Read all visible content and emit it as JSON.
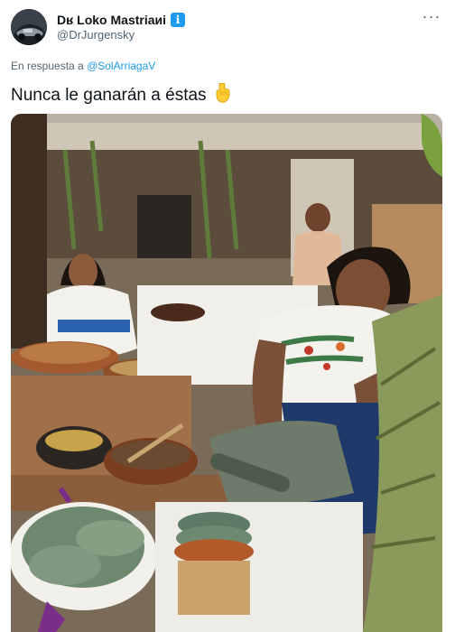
{
  "tweet": {
    "display_name": "Dʁ Loko Mastriaиi",
    "verified_icon": "verified-badge-icon",
    "verified_glyph": "i",
    "handle": "@DrJurgensky",
    "reply_prefix": "En respuesta a",
    "reply_mention": "@SolArriagaV",
    "text": "Nunca le ganarán a éstas",
    "emoji": "pointing-down-hand-icon",
    "more_glyph": "···"
  },
  "colors": {
    "accent": "#1d9bf0",
    "secondary_text": "#536471",
    "primary_text": "#0f1419"
  }
}
